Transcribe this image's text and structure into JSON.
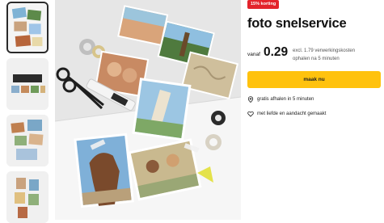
{
  "product": {
    "badge": "15% korting",
    "title": "foto snelservice",
    "price_prefix": "vanaf",
    "price": "0.29",
    "fee_line1": "excl. 1.79 verwerkingskosten",
    "fee_line2": "ophalen na 5 minuten",
    "cta_label": "maak nu"
  },
  "features": [
    {
      "icon": "location-pin-icon",
      "text": "gratis afhalen in 5 minuten"
    },
    {
      "icon": "heart-icon",
      "text": "met liefde en aandacht gemaakt"
    }
  ],
  "colors": {
    "badge": "#e3242b",
    "cta": "#ffc20e",
    "text": "#1a1a1a"
  }
}
